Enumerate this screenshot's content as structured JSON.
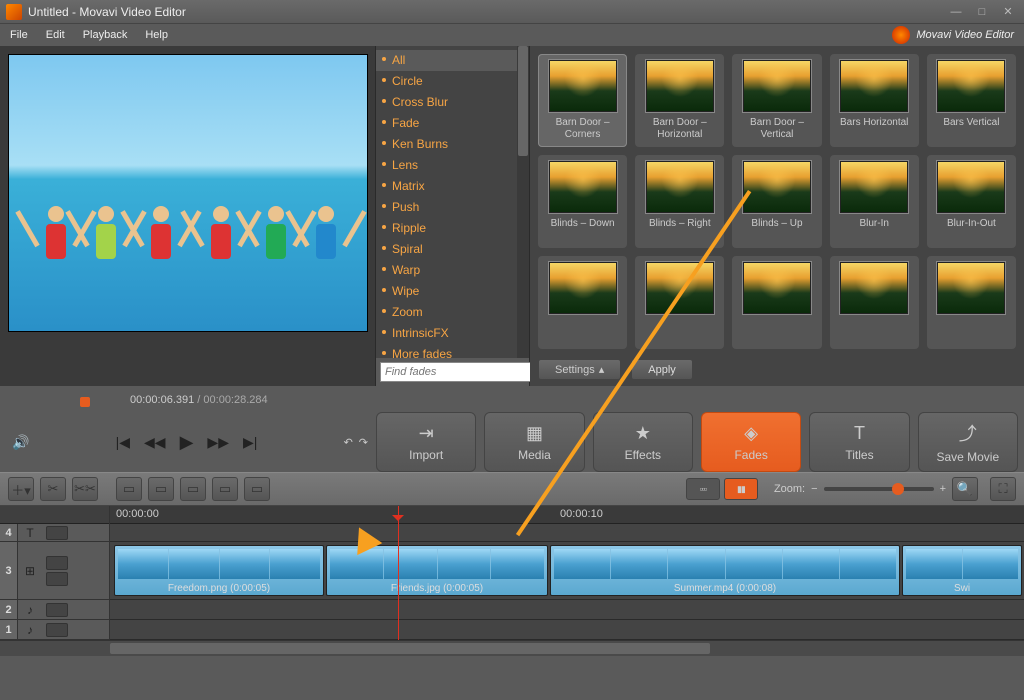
{
  "window": {
    "title": "Untitled - Movavi Video Editor",
    "brand": "Movavi Video Editor"
  },
  "menu": {
    "file": "File",
    "edit": "Edit",
    "playback": "Playback",
    "help": "Help"
  },
  "categories": {
    "items": [
      "All",
      "Circle",
      "Cross Blur",
      "Fade",
      "Ken Burns",
      "Lens",
      "Matrix",
      "Push",
      "Ripple",
      "Spiral",
      "Warp",
      "Wipe",
      "Zoom",
      "IntrinsicFX",
      "More fades"
    ],
    "selected": 0,
    "find_placeholder": "Find fades"
  },
  "fades": {
    "tiles": [
      {
        "label": "Barn Door – Corners"
      },
      {
        "label": "Barn Door – Horizontal"
      },
      {
        "label": "Barn Door – Vertical"
      },
      {
        "label": "Bars Horizontal"
      },
      {
        "label": "Bars Vertical"
      },
      {
        "label": "Blinds – Down"
      },
      {
        "label": "Blinds – Right"
      },
      {
        "label": "Blinds – Up"
      },
      {
        "label": "Blur-In"
      },
      {
        "label": "Blur-In-Out"
      },
      {
        "label": ""
      },
      {
        "label": ""
      },
      {
        "label": ""
      },
      {
        "label": ""
      },
      {
        "label": ""
      }
    ],
    "settings_label": "Settings",
    "apply_label": "Apply"
  },
  "playback": {
    "position": "00:00:06.391",
    "duration": "00:00:28.284"
  },
  "modes": {
    "import": "Import",
    "media": "Media",
    "effects": "Effects",
    "fades": "Fades",
    "titles": "Titles",
    "save": "Save Movie",
    "active": "fades"
  },
  "toolbar": {
    "zoom_label": "Zoom:"
  },
  "ruler": {
    "t0": "00:00:00",
    "t10": "00:00:10"
  },
  "tracks": {
    "num4": "4",
    "num3": "3",
    "num2": "2",
    "num1": "1",
    "clip1_label": "Freedom.png (0:00:05)",
    "clip2_label": "Friends.jpg (0:00:05)",
    "clip3_label": "Summer.mp4 (0:00:08)",
    "clip4_label": "Swi"
  }
}
